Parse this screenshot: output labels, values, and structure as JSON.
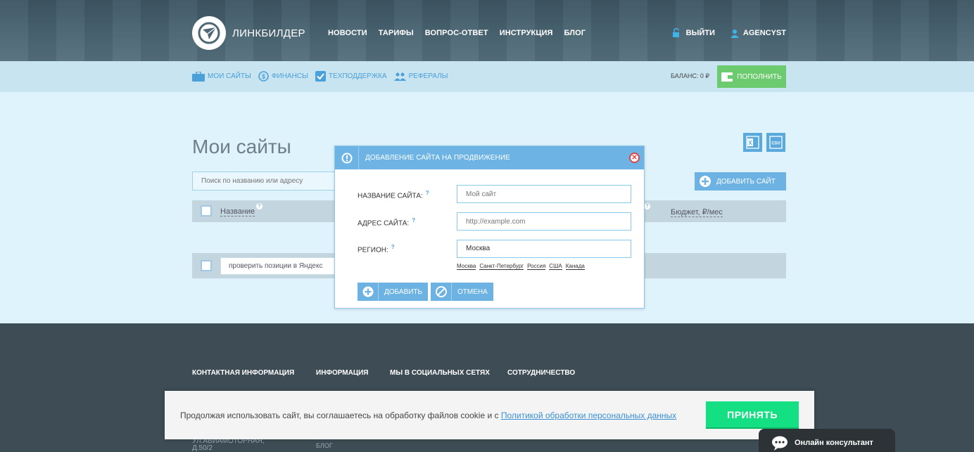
{
  "header": {
    "logo_text": "ЛИНКБИЛДЕР",
    "nav": [
      "НОВОСТИ",
      "ТАРИФЫ",
      "ВОПРОС-ОТВЕТ",
      "ИНСТРУКЦИЯ",
      "БЛОГ"
    ],
    "logout": "ВЫЙТИ",
    "username": "AGENCYST"
  },
  "subnav": {
    "items": [
      "МОИ САЙТЫ",
      "ФИНАНСЫ",
      "ТЕХПОДДЕРЖКА",
      "РЕФЕРАЛЫ"
    ],
    "balance": "БАЛАНС: 0 ₽",
    "topup": "ПОПОЛНИТЬ"
  },
  "main": {
    "title": "Мои сайты",
    "search_placeholder": "Поиск по названию или адресу",
    "add_site": "ДОБАВИТЬ САЙТ",
    "col_name": "Название",
    "col_budget": "Бюджет, ₽/мес",
    "check_positions": "проверить позиции в Яндекс"
  },
  "modal": {
    "title": "ДОБАВЛЕНИЕ САЙТА НА ПРОДВИЖЕНИЕ",
    "name_label": "НАЗВАНИЕ САЙТА:",
    "name_placeholder": "Мой сайт",
    "url_label": "АДРЕС САЙТА:",
    "url_placeholder": "http://example.com",
    "region_label": "РЕГИОН:",
    "region_value": "Москва",
    "hint": "?",
    "region_options": [
      "Москва",
      "Санкт-Петербург",
      "Россия",
      "США",
      "Канада"
    ],
    "add": "ДОБАВИТЬ",
    "cancel": "ОТМЕНА"
  },
  "footer": {
    "columns": [
      "КОНТАКТНАЯ ИНФОРМАЦИЯ",
      "ИНФОРМАЦИЯ",
      "МЫ В СОЦИАЛЬНЫХ СЕТЯХ",
      "СОТРУДНИЧЕСТВО"
    ],
    "address_line1": "УЛ.АВИАМОТОРНАЯ,",
    "address_line2": "Д.50/2",
    "blog": "БЛОГ"
  },
  "cookie": {
    "text": "Продолжая использовать сайт, вы соглашаетесь на обработку файлов cookie и с ",
    "link": "Политикой обработки персональных данных",
    "accept": "ПРИНЯТЬ"
  },
  "chat": {
    "label": "Онлайн консультант"
  },
  "colors": {
    "accent": "#6cb2e2",
    "green": "#6ccb6e",
    "accept": "#14e083",
    "header": "#4a6573",
    "footer": "#3e4c55"
  }
}
